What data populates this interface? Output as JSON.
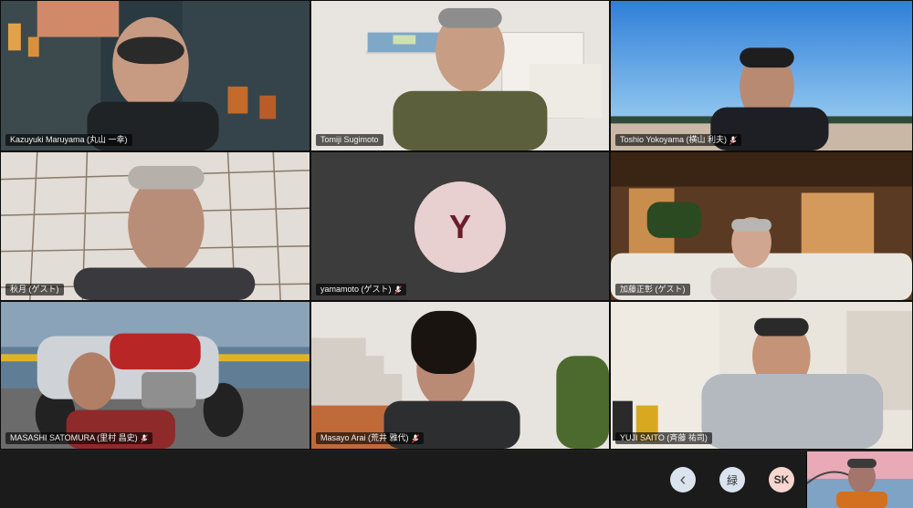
{
  "participants": [
    {
      "name": "Kazuyuki Maruyama (丸山 一幸)",
      "muted": false
    },
    {
      "name": "Tomiji Sugimoto",
      "muted": false
    },
    {
      "name": "Toshio Yokoyama (横山 利夫)",
      "muted": true
    },
    {
      "name": "秋月 (ゲスト)",
      "muted": false
    },
    {
      "name": "yamamoto (ゲスト)",
      "muted": true,
      "avatar_letter": "Y"
    },
    {
      "name": "加藤正彰 (ゲスト)",
      "muted": false
    },
    {
      "name": "MASASHI SATOMURA (里村 昌史)",
      "muted": true
    },
    {
      "name": "Masayo Arai (荒井 雅代)",
      "muted": true
    },
    {
      "name": "YUJI SAITO (斉藤 祐司)",
      "muted": false
    }
  ],
  "controls": {
    "back_icon": "chevron-left-icon",
    "back_glyph": "‹",
    "avatar_1": "緑",
    "avatar_2": "SK"
  },
  "colors": {
    "avatar_bg": "#e8cfd0",
    "avatar_text": "#6a1d2b",
    "control_bg": "#dbe3ee"
  }
}
